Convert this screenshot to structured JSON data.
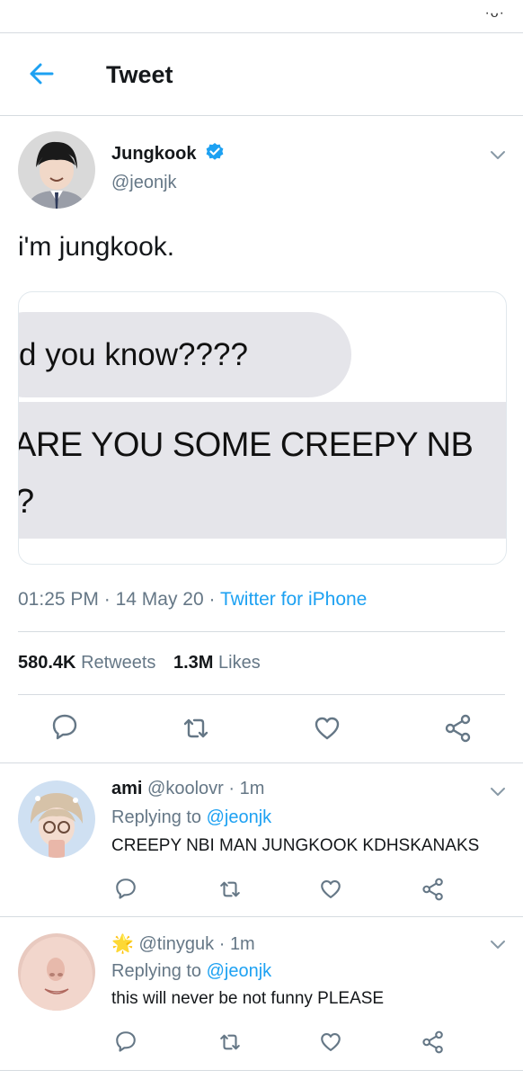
{
  "status_bar": {
    "glyph": "·ᴗ·"
  },
  "header": {
    "title": "Tweet",
    "back_icon": "arrow-left-icon"
  },
  "tweet": {
    "author_name": "Jungkook",
    "author_handle": "@jeonjk",
    "verified": true,
    "text": "i'm jungkook.",
    "media": {
      "line1": "d you know????",
      "line2": "ARE YOU SOME CREEPY NB",
      "line3": "?"
    },
    "time": "01:25 PM",
    "date": "14 May 20",
    "source": "Twitter for iPhone",
    "retweets_count": "580.4K",
    "retweets_label": "Retweets",
    "likes_count": "1.3M",
    "likes_label": "Likes",
    "separator": "·"
  },
  "replies": [
    {
      "name": "ami",
      "handle": "@koolovr",
      "time": "1m",
      "replying_label": "Replying to",
      "replying_handle": "@jeonjk",
      "text": "CREEPY NBI MAN JUNGKOOK KDHSKANAKS"
    },
    {
      "name": "🌟",
      "handle": "@tinyguk",
      "time": "1m",
      "replying_label": "Replying to",
      "replying_handle": "@jeonjk",
      "text": "this will never be not funny PLEASE"
    }
  ],
  "colors": {
    "accent": "#1da1f2",
    "muted": "#657786",
    "divider": "#d6dbe0",
    "verified": "#1da1f2"
  }
}
